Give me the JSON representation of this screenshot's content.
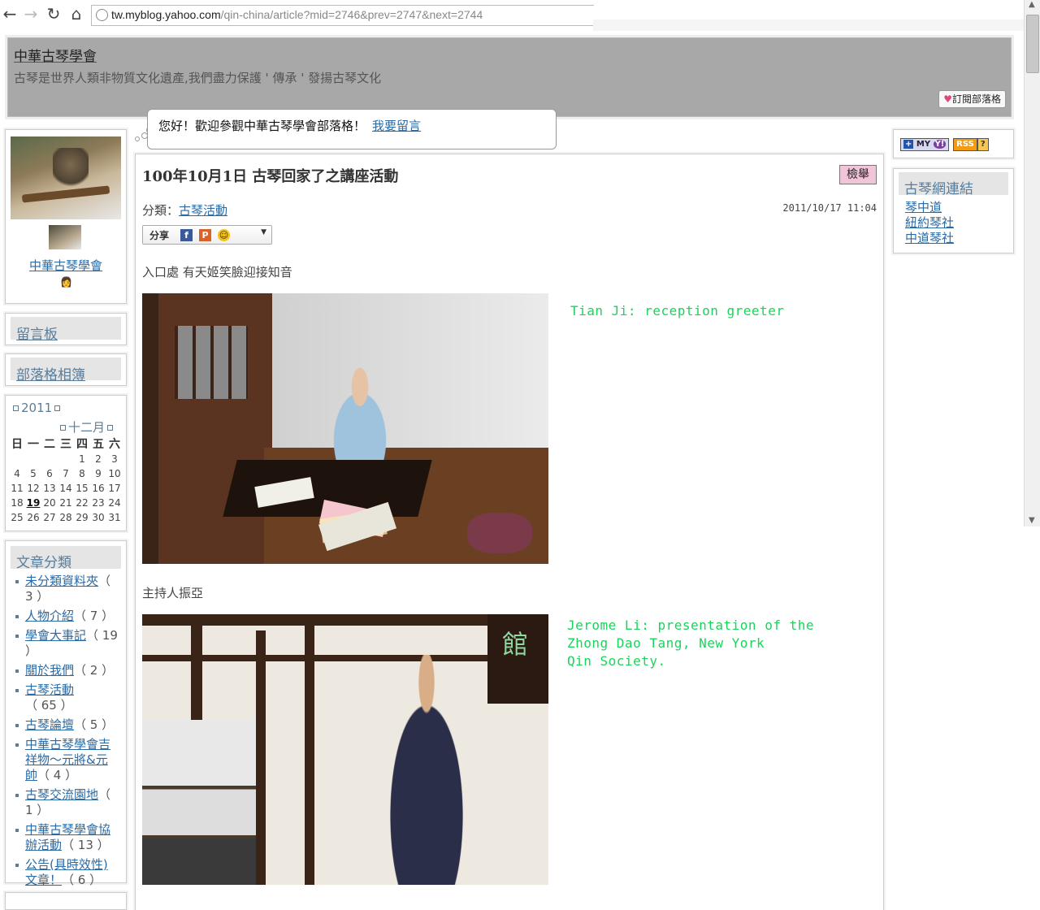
{
  "browser": {
    "url_host": "tw.myblog.yahoo.com",
    "url_path": "/qin-china/article?mid=2746&prev=2747&next=2744",
    "icons": [
      "back-arrow-icon",
      "forward-arrow-icon",
      "reload-icon",
      "home-icon",
      "globe-icon"
    ]
  },
  "header": {
    "title": "中華古琴學會",
    "description": "古琴是世界人類非物質文化遺產,我們盡力保護 ' 傳承 ' 發揚古琴文化",
    "subscribe_label": "訂閱部落格"
  },
  "greeting": {
    "text": "您好！歡迎參觀中華古琴學會部落格！",
    "link": "我要留言"
  },
  "profile": {
    "name": "中華古琴學會"
  },
  "sidebar": {
    "guestbook": "留言板",
    "album": "部落格相簿",
    "calendar": {
      "year": "2011",
      "month": "十二月",
      "weekdays": [
        "日",
        "一",
        "二",
        "三",
        "四",
        "五",
        "六"
      ],
      "weeks": [
        [
          "",
          "",
          "",
          "",
          "1",
          "2",
          "3"
        ],
        [
          "4",
          "5",
          "6",
          "7",
          "8",
          "9",
          "10"
        ],
        [
          "11",
          "12",
          "13",
          "14",
          "15",
          "16",
          "17"
        ],
        [
          "18",
          "19",
          "20",
          "21",
          "22",
          "23",
          "24"
        ],
        [
          "25",
          "26",
          "27",
          "28",
          "29",
          "30",
          "31"
        ]
      ],
      "today": "19"
    },
    "categories_title": "文章分類",
    "categories": [
      {
        "name": "未分類資料夾",
        "count": "（ 3 ）"
      },
      {
        "name": "人物介紹",
        "count": "（ 7 ）"
      },
      {
        "name": "學會大事記",
        "count": "（ 19 ）"
      },
      {
        "name": "關於我們",
        "count": "（ 2 ）"
      },
      {
        "name": "古琴活動",
        "count": "（ 65 ）"
      },
      {
        "name": "古琴論壇",
        "count": "（ 5 ）"
      },
      {
        "name": "中華古琴學會吉祥物～元將&元帥",
        "count": "（ 4 ）"
      },
      {
        "name": "古琴交流園地",
        "count": "（ 1 ）"
      },
      {
        "name": "中華古琴學會協辦活動",
        "count": "（ 13 ）"
      },
      {
        "name": "公告(具時效性)文章！",
        "count": "（ 6 ）"
      }
    ]
  },
  "article": {
    "title": "100年10月1日 古琴回家了之講座活動",
    "report_label": "檢舉",
    "category_label": "分類：",
    "category": "古琴活動",
    "date": "2011/10/17 11:04",
    "share_label": "分享",
    "para1": "入口處 有天姬笑臉迎接知音",
    "caption1": "Tian Ji: reception greeter",
    "para2": "主持人振亞",
    "caption2": "Jerome Li: presentation of the\nZhong Dao Tang, New York\nQin Society.",
    "photo2_sign": "館"
  },
  "right": {
    "my_label": "MY",
    "rss_label": "RSS",
    "help_label": "?",
    "links_title": "古琴網連結",
    "links": [
      "琴中道",
      "紐約琴社",
      "中道琴社"
    ]
  }
}
